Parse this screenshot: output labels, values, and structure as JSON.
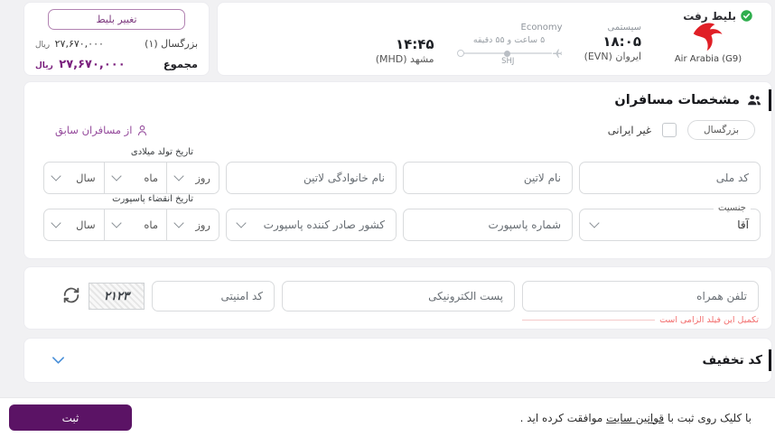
{
  "colors": {
    "accent_purple": "#7a1f7d",
    "dark_purple_button": "#5b1365",
    "error_red": "#f26d6d",
    "link_purple": "#94499b",
    "chevron_blue": "#4a90d9",
    "logo_red": "#e01f26",
    "verified_green": "#2fae4e",
    "page_bg": "#f1f1f3"
  },
  "icons": {
    "verified": "green-circle-check",
    "airline_logo": "red-bird",
    "plane": "plane-left",
    "passengers": "two-people",
    "person": "person-outline",
    "refresh": "circular-arrows",
    "chevron_down": "v-shape"
  },
  "fare_summary": {
    "change_ticket_label": "تغییر بلیط",
    "rows": [
      {
        "label": "بزرگسال (۱)",
        "amount": "۲۷,۶۷۰,۰۰۰",
        "currency": "ریال"
      },
      {
        "label": "مجموع",
        "amount": "۲۷,۶۷۰,۰۰۰",
        "currency": "ریال"
      }
    ]
  },
  "flight": {
    "title": "بلیط رفت",
    "airline": "Air Arabia (G9)",
    "fare_type": "سیستمی",
    "cabin": "Economy",
    "departure_time": "۱۸:۰۵",
    "departure_city": "ایروان (EVN)",
    "duration": "۵ ساعت و ۵۵ دقیقه",
    "stop_code": "SHJ",
    "arrival_time": "۱۴:۴۵",
    "arrival_city": "مشهد (MHD)"
  },
  "passengers": {
    "title": "مشخصات مسافران",
    "type_badge": "بزرگسال",
    "non_iranian_label": "غیر ایرانی",
    "previous_passengers_link": "از مسافران سابق",
    "fields": {
      "national_code": "کد ملی",
      "latin_first_name": "نام لاتین",
      "latin_last_name": "نام خانوادگی لاتین",
      "birth_date_label": "تاریخ تولد میلادی",
      "day": "روز",
      "month": "ماه",
      "year": "سال",
      "gender_label": "جنسیت",
      "gender_value": "آقا",
      "passport_number": "شماره پاسپورت",
      "passport_country": "کشور صادر کننده پاسپورت",
      "passport_expiry_label": "تاریخ انقضاء پاسپورت"
    }
  },
  "contact": {
    "mobile_placeholder": "تلفن همراه",
    "mobile_error": "تکمیل این فیلد الزامی است",
    "email_placeholder": "پست الکترونیکی",
    "captcha_placeholder": "کد امنیتی",
    "captcha_code": "۲۱۲۳"
  },
  "discount": {
    "title": "کد تخفیف"
  },
  "footer": {
    "agreement_prefix": "با کلیک روی ثبت با ",
    "agreement_link": "قوانین سایت",
    "agreement_suffix": " موافقت کرده اید .",
    "submit_label": "ثبت"
  }
}
